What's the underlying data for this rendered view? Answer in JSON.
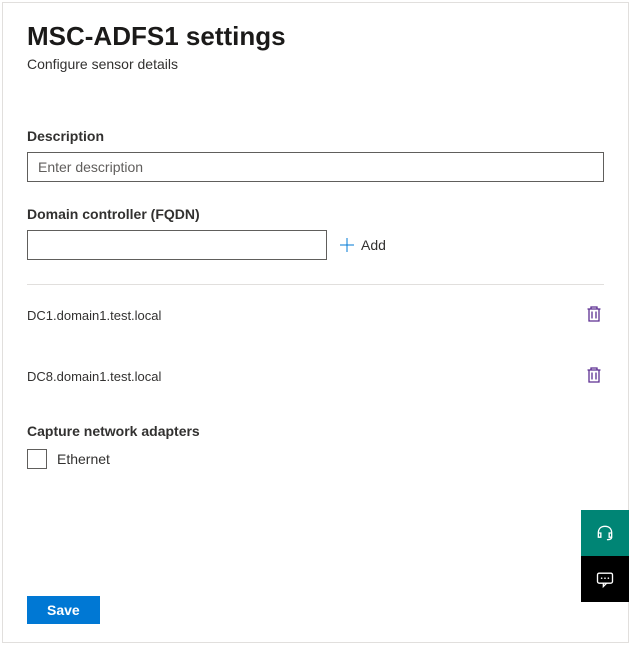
{
  "header": {
    "title": "MSC-ADFS1 settings",
    "subtitle": "Configure sensor details"
  },
  "description": {
    "label": "Description",
    "placeholder": "Enter description",
    "value": ""
  },
  "fqdn": {
    "label": "Domain controller (FQDN)",
    "value": "",
    "add_label": "Add"
  },
  "dc_list": [
    {
      "name": "DC1.domain1.test.local"
    },
    {
      "name": "DC8.domain1.test.local"
    }
  ],
  "adapters": {
    "label": "Capture network adapters",
    "items": [
      {
        "label": "Ethernet",
        "checked": false
      }
    ]
  },
  "actions": {
    "save": "Save"
  }
}
